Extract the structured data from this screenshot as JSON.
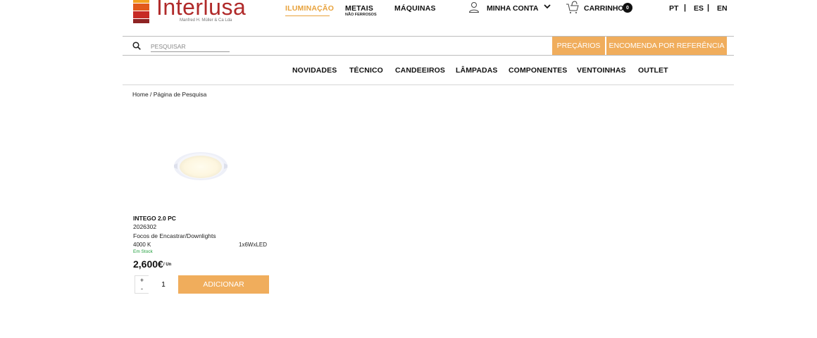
{
  "colors": {
    "accent": "#f0ad5c",
    "active_nav": "#e8a23c",
    "brand_red": "#b02a2a",
    "stock_green": "#1e9d3a",
    "logo_stripes": [
      "#f4a21f",
      "#e25a1c",
      "#c72a24",
      "#8e2323"
    ]
  },
  "logo": {
    "word": "Interlusa",
    "registered": "®",
    "subtitle": "Manfred H. Müller & Ca Lda"
  },
  "header": {
    "nav": [
      {
        "label": "ILUMINAÇÃO"
      },
      {
        "label": "METAIS",
        "sublabel": "NÃO FERROSOS"
      },
      {
        "label": "MÁQUINAS"
      }
    ],
    "account": {
      "label": "MINHA CONTA",
      "icon": "user-icon",
      "chevron": "chevron-down-icon"
    },
    "cart": {
      "label": "CARRINHO",
      "count": "0",
      "icon": "cart-icon"
    },
    "languages": [
      "PT",
      "ES",
      "EN"
    ],
    "lang_separator": "|"
  },
  "search": {
    "placeholder": "PESQUISAR",
    "icon": "search-icon"
  },
  "actions": {
    "precarios": "PREÇÁRIOS",
    "encomenda": "ENCOMENDA POR REFERÊNCIA"
  },
  "categories": [
    "NOVIDADES",
    "TÉCNICO",
    "CANDEEIROS",
    "LÂMPADAS",
    "COMPONENTES",
    "VENTOINHAS",
    "OUTLET"
  ],
  "breadcrumb": "Home / Página de Pesquisa",
  "product": {
    "name": "INTEGO 2.0 PC",
    "reference": "2026302",
    "category": "Focos de Encastrar/Downlights",
    "color_temp": "4000 K",
    "power": "1x6WxLED",
    "stock": "Em Stock",
    "price": "2,600€",
    "unit": "/ Un",
    "quantity": "1",
    "plus": "+",
    "minus": "-",
    "add_label": "ADICIONAR"
  }
}
